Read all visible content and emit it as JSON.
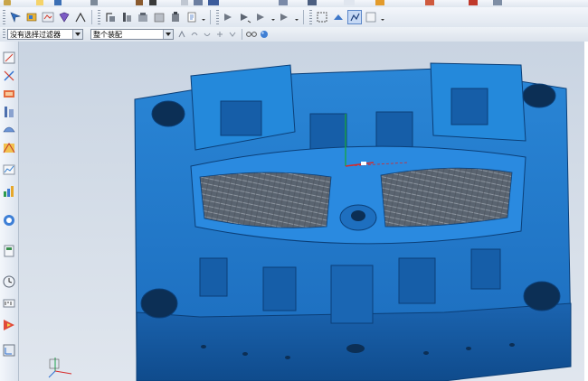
{
  "toolbar": {
    "filter_dropdown": {
      "value": "没有选择过滤器"
    },
    "assembly_dropdown": {
      "value": "整个装配"
    }
  },
  "icons": {
    "top_row": [
      "folder-open-icon",
      "new-file-icon",
      "save-icon",
      "print-icon",
      "cut-icon",
      "copy-icon",
      "paste-icon",
      "undo-icon",
      "redo-icon",
      "delete-icon",
      "help-icon",
      "layer-icon",
      "zoom-icon",
      "rotate-icon",
      "refresh-icon",
      "render-icon"
    ],
    "main_row": [
      "selection-icon",
      "snap-icon",
      "move-icon",
      "copy-object-icon",
      "mirror-icon",
      "scale-icon",
      "align-icon",
      "document-icon",
      "point-icon",
      "filter-icon",
      "arrow-icon",
      "analysis-icon",
      "select-all-icon",
      "view-icon",
      "dynamic-icon",
      "shaded-icon"
    ],
    "filter_row": [
      "select-face-icon",
      "undo-select-icon",
      "redo-select-icon",
      "point-snap-icon",
      "glasses-icon",
      "sphere-icon"
    ],
    "left_column": [
      "sketch-icon",
      "datum-axis-icon",
      "mold-wizard-icon",
      "parting-icon",
      "surface-icon",
      "feature-icon",
      "analysis-icon",
      "graph-icon",
      "mold-tools-icon",
      "clock-icon",
      "measure-icon",
      "wcs-icon"
    ]
  },
  "colors": {
    "mold_blue": "#1f78c8",
    "mold_blue_dark": "#0f4f8f",
    "grille_gray": "#6a7480",
    "toolbar_bg": "#e6ecf3",
    "viewport_bg": "#cdd7e4"
  }
}
